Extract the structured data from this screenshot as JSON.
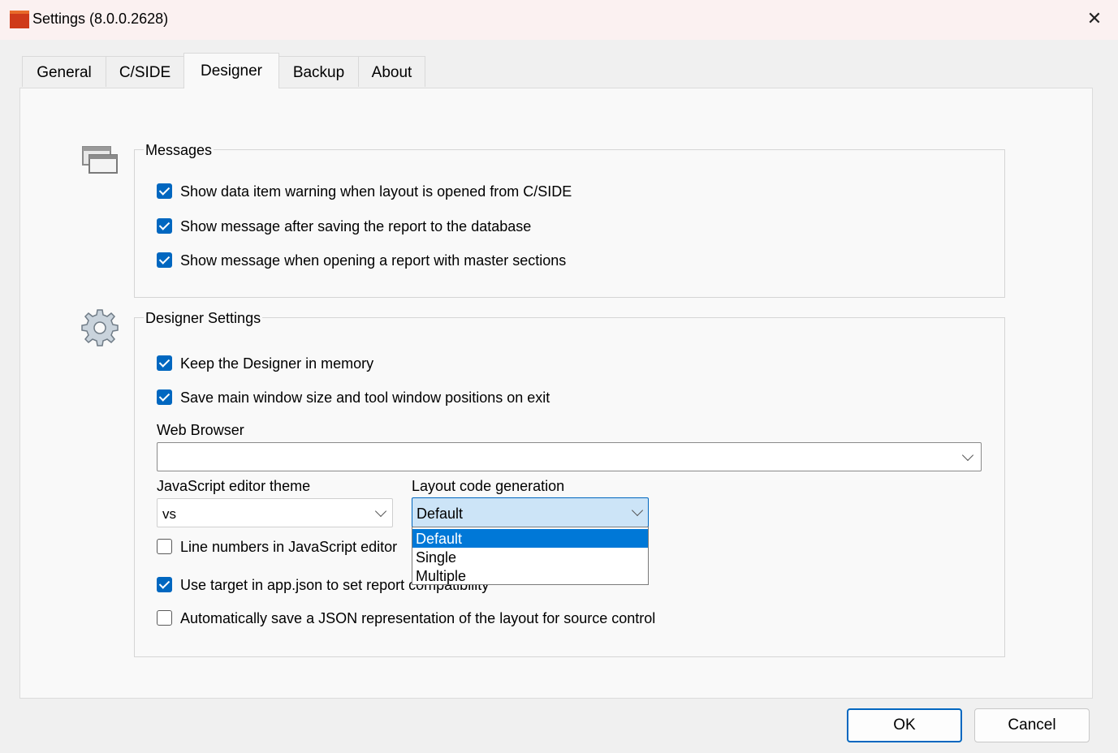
{
  "window": {
    "title": "Settings (8.0.0.2628)",
    "close_symbol": "✕"
  },
  "tabs": [
    {
      "label": "General"
    },
    {
      "label": "C/SIDE"
    },
    {
      "label": "Designer"
    },
    {
      "label": "Backup"
    },
    {
      "label": "About"
    }
  ],
  "active_tab": "Designer",
  "messages": {
    "legend": "Messages",
    "icon": "windows-icon",
    "items": [
      {
        "label": "Show data item warning when layout is opened from C/SIDE",
        "checked": true
      },
      {
        "label": "Show message after saving the report to the database",
        "checked": true
      },
      {
        "label": "Show message when opening a report with master sections",
        "checked": true
      }
    ]
  },
  "designer": {
    "legend": "Designer Settings",
    "icon": "gear-icon",
    "keep_in_memory": {
      "label": "Keep the Designer in memory",
      "checked": true
    },
    "save_window": {
      "label": "Save main window size and tool window positions on exit",
      "checked": true
    },
    "web_browser": {
      "label": "Web Browser",
      "value": ""
    },
    "js_theme": {
      "label": "JavaScript editor theme",
      "value": "vs"
    },
    "layout_codegen": {
      "label": "Layout code generation",
      "value": "Default",
      "options": [
        "Default",
        "Single",
        "Multiple"
      ]
    },
    "line_numbers": {
      "label": "Line numbers in JavaScript editor",
      "checked": false
    },
    "use_target": {
      "label": "Use target in app.json to set report compatibility",
      "checked": true
    },
    "auto_save_json": {
      "label": "Automatically save a JSON representation of the layout for source control",
      "checked": false
    }
  },
  "buttons": {
    "ok": "OK",
    "cancel": "Cancel"
  },
  "colors": {
    "accent": "#0067c0",
    "selection": "#0078d7",
    "combo_focus": "#cce4f7"
  }
}
